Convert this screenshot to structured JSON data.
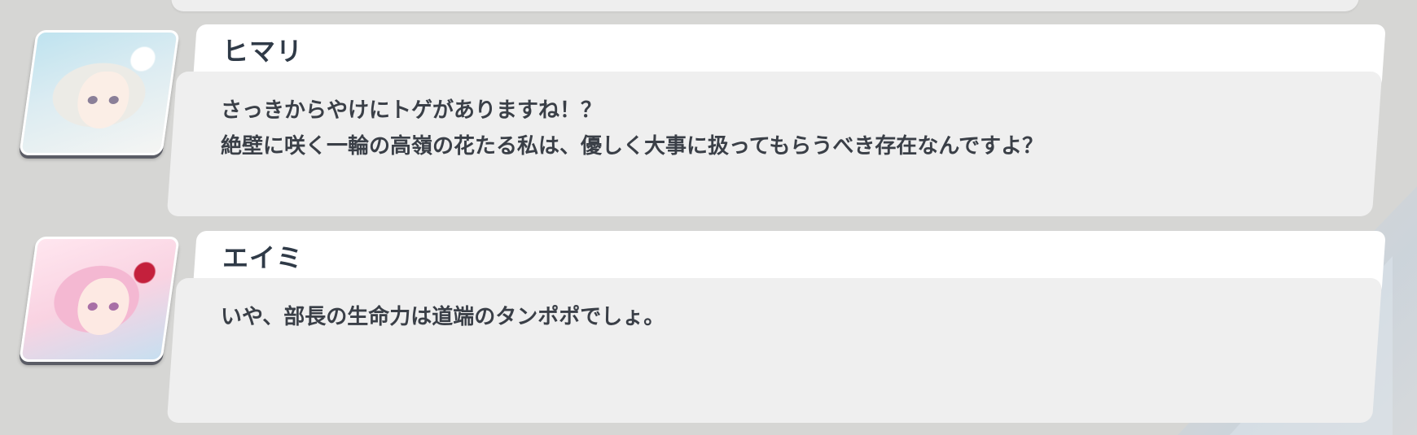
{
  "dialogue": [
    {
      "speaker": "ヒマリ",
      "portrait_icon": "himari-portrait",
      "lines": [
        "さっきからやけにトゲがありますね！？",
        "絶壁に咲く一輪の高嶺の花たる私は、優しく大事に扱ってもらうべき存在なんですよ？"
      ]
    },
    {
      "speaker": "エイミ",
      "portrait_icon": "eimi-portrait",
      "lines": [
        "いや、部長の生命力は道端のタンポポでしょ。"
      ]
    }
  ],
  "colors": {
    "background": "#d6d6d4",
    "name_strip": "#ffffff",
    "message_body": "#efefef",
    "speaker_text": "#2f3a47",
    "message_text": "#3a3f47"
  }
}
